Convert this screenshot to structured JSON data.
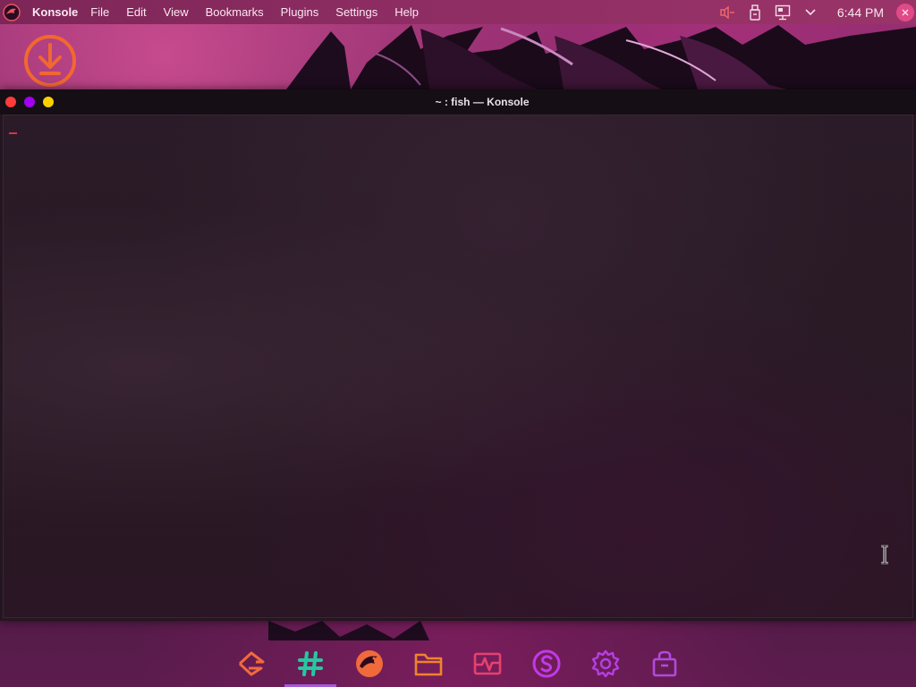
{
  "panel": {
    "app_name": "Konsole",
    "menu": [
      "File",
      "Edit",
      "View",
      "Bookmarks",
      "Plugins",
      "Settings",
      "Help"
    ],
    "clock": "6:44 PM",
    "tray_icons": [
      "volume-icon",
      "usb-drive-icon",
      "network-icon",
      "chevron-down-icon"
    ]
  },
  "window": {
    "title": "~ : fish — Konsole",
    "buttons": [
      "close",
      "minimize",
      "maximize"
    ]
  },
  "dock": {
    "items": [
      "gitkraken-icon",
      "hashtag-app-icon",
      "garuda-dragon-icon",
      "folder-icon",
      "system-monitor-icon",
      "s-app-icon",
      "settings-gear-icon",
      "store-bag-icon"
    ],
    "active_index": 1
  },
  "colors": {
    "accent": "#f06a3c",
    "close": "#ff3b3b",
    "minimize": "#a100f2",
    "maximize": "#ffcf00",
    "dock_active": "#a45bd8"
  }
}
